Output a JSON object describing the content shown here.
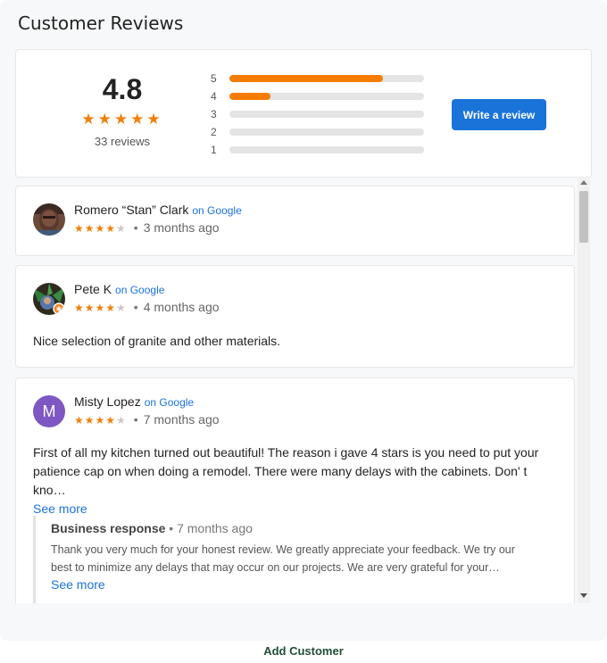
{
  "title": "Customer Reviews",
  "summary": {
    "average": "4.8",
    "review_count": "33 reviews",
    "stars": "★★★★★",
    "bars": [
      {
        "label": "5",
        "fraction": 0.79
      },
      {
        "label": "4",
        "fraction": 0.21
      },
      {
        "label": "3",
        "fraction": 0
      },
      {
        "label": "2",
        "fraction": 0
      },
      {
        "label": "1",
        "fraction": 0
      }
    ],
    "write_review_label": "Write a review"
  },
  "reviews": [
    {
      "name": "Romero “Stan” Clark",
      "source": "on Google",
      "rating": 4,
      "time": "3 months ago",
      "avatar_icon": "person-photo"
    },
    {
      "name": "Pete K",
      "source": "on Google",
      "rating": 4,
      "time": "4 months ago",
      "text": "Nice selection of granite and other materials.",
      "avatar_icon": "person-photo-with-badge"
    },
    {
      "name": "Misty Lopez",
      "source": "on Google",
      "rating": 4,
      "time": "7 months ago",
      "avatar_letter": "M",
      "text": "First of all my kitchen turned out beautiful! The reason i gave 4 stars is you need to put your patience cap on when doing a remodel. There were many delays with the cabinets. Don' t kno…",
      "see_more": "See more",
      "business_response": {
        "label": "Business response",
        "time": "7 months ago",
        "text": "Thank you very much for your honest review. We greatly appreciate your feedback. We try our best to minimize any delays that may occur on our projects. We are very grateful for your…",
        "see_more": "See more"
      }
    }
  ],
  "stars": {
    "filled": "★★★★",
    "empty": "★",
    "separator": "•"
  },
  "footer": {
    "link": "Add Customer"
  },
  "colors": {
    "accent": "#1a73d9",
    "star": "#ef7f0b",
    "bar": "#f57c00",
    "avatar_m": "#7e57c2"
  }
}
